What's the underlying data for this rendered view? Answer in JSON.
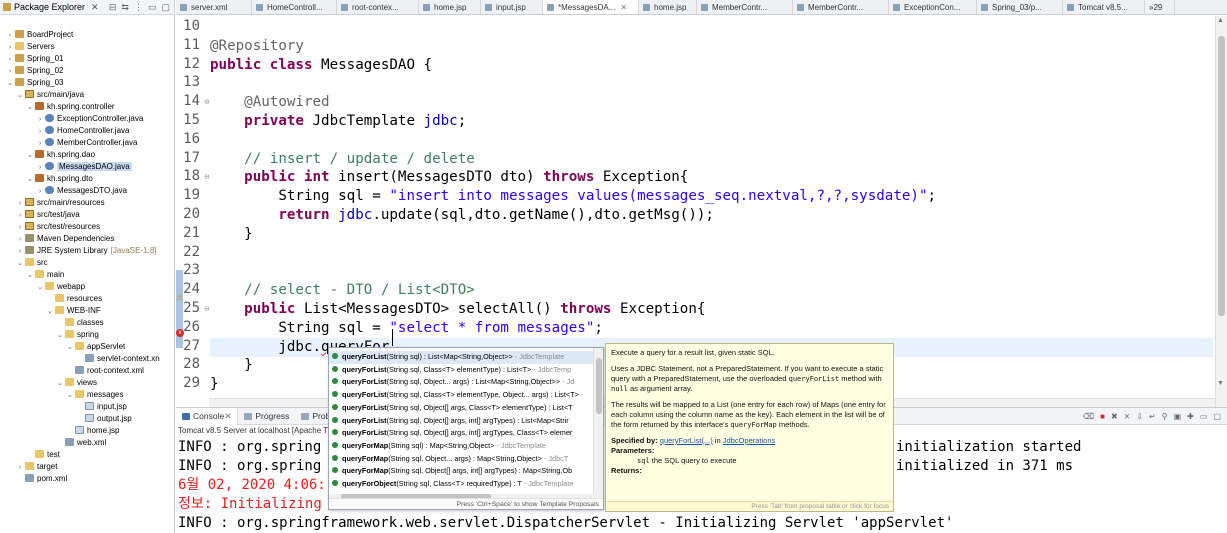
{
  "package_explorer": {
    "title": "Package Explorer",
    "tree": [
      {
        "label": "BoardProject",
        "icon": "project",
        "indent": 0,
        "twisty": ">"
      },
      {
        "label": "Servers",
        "icon": "folder",
        "indent": 0,
        "twisty": ">"
      },
      {
        "label": "Spring_01",
        "icon": "project",
        "indent": 0,
        "twisty": ">"
      },
      {
        "label": "Spring_02",
        "icon": "project",
        "indent": 0,
        "twisty": ">"
      },
      {
        "label": "Spring_03",
        "icon": "project",
        "indent": 0,
        "twisty": "v"
      },
      {
        "label": "src/main/java",
        "icon": "srcfolder",
        "indent": 1,
        "twisty": "v"
      },
      {
        "label": "kh.spring.controller",
        "icon": "pkg",
        "indent": 2,
        "twisty": "v"
      },
      {
        "label": "ExceptionController.java",
        "icon": "java",
        "indent": 3,
        "twisty": ">"
      },
      {
        "label": "HomeController.java",
        "icon": "java",
        "indent": 3,
        "twisty": ">"
      },
      {
        "label": "MemberController.java",
        "icon": "java",
        "indent": 3,
        "twisty": ">"
      },
      {
        "label": "kh.spring.dao",
        "icon": "pkg",
        "indent": 2,
        "twisty": "v"
      },
      {
        "label": "MessagesDAO.java",
        "icon": "java",
        "indent": 3,
        "twisty": ">",
        "selected": true
      },
      {
        "label": "kh.spring.dto",
        "icon": "pkg",
        "indent": 2,
        "twisty": "v"
      },
      {
        "label": "MessagesDTO.java",
        "icon": "java",
        "indent": 3,
        "twisty": ">"
      },
      {
        "label": "src/main/resources",
        "icon": "srcfolder",
        "indent": 1,
        "twisty": ">"
      },
      {
        "label": "src/test/java",
        "icon": "srcfolder",
        "indent": 1,
        "twisty": ">"
      },
      {
        "label": "src/test/resources",
        "icon": "srcfolder",
        "indent": 1,
        "twisty": ">"
      },
      {
        "label": "Maven Dependencies",
        "icon": "lib",
        "indent": 1,
        "twisty": ">"
      },
      {
        "label": "JRE System Library",
        "extra": "[JavaSE-1.8]",
        "icon": "lib",
        "indent": 1,
        "twisty": ">"
      },
      {
        "label": "src",
        "icon": "folder",
        "indent": 1,
        "twisty": "v"
      },
      {
        "label": "main",
        "icon": "folder",
        "indent": 2,
        "twisty": "v"
      },
      {
        "label": "webapp",
        "icon": "folder",
        "indent": 3,
        "twisty": "v"
      },
      {
        "label": "resources",
        "icon": "folder",
        "indent": 4,
        "twisty": ""
      },
      {
        "label": "WEB-INF",
        "icon": "folder",
        "indent": 4,
        "twisty": "v"
      },
      {
        "label": "classes",
        "icon": "folder",
        "indent": 5,
        "twisty": ""
      },
      {
        "label": "spring",
        "icon": "folder",
        "indent": 5,
        "twisty": "v"
      },
      {
        "label": "appServlet",
        "icon": "folder",
        "indent": 6,
        "twisty": "v"
      },
      {
        "label": "servlet-context.xn",
        "icon": "xml",
        "indent": 7,
        "twisty": ""
      },
      {
        "label": "root-context.xml",
        "icon": "xml",
        "indent": 6,
        "twisty": ""
      },
      {
        "label": "views",
        "icon": "folder",
        "indent": 5,
        "twisty": "v"
      },
      {
        "label": "messages",
        "icon": "folder",
        "indent": 6,
        "twisty": "v"
      },
      {
        "label": "input.jsp",
        "icon": "jsp",
        "indent": 7,
        "twisty": ""
      },
      {
        "label": "output.jsp",
        "icon": "jsp",
        "indent": 7,
        "twisty": ""
      },
      {
        "label": "home.jsp",
        "icon": "jsp",
        "indent": 6,
        "twisty": ""
      },
      {
        "label": "web.xml",
        "icon": "xml",
        "indent": 5,
        "twisty": ""
      },
      {
        "label": "test",
        "icon": "folder",
        "indent": 2,
        "twisty": ""
      },
      {
        "label": "target",
        "icon": "folder",
        "indent": 1,
        "twisty": ">"
      },
      {
        "label": "pom.xml",
        "icon": "xml",
        "indent": 1,
        "twisty": ""
      }
    ]
  },
  "editor_tabs": [
    {
      "label": "server.xml",
      "width": 76
    },
    {
      "label": "HomeControll...",
      "width": 85
    },
    {
      "label": "root-contex...",
      "width": 82
    },
    {
      "label": "home.jsp",
      "width": 62
    },
    {
      "label": "input.jsp",
      "width": 62
    },
    {
      "label": "*MessagesDA...",
      "width": 96,
      "active": true
    },
    {
      "label": "home.jsp",
      "width": 58
    },
    {
      "label": "MemberContr...",
      "width": 96
    },
    {
      "label": "MemberContr...",
      "width": 96
    },
    {
      "label": "ExceptionCon...",
      "width": 88
    },
    {
      "label": "Spring_03/p...",
      "width": 86
    },
    {
      "label": "Tomcat v8.5...",
      "width": 82
    },
    {
      "label": "»29",
      "width": 30
    }
  ],
  "code": {
    "lines": [
      {
        "n": "10",
        "html": ""
      },
      {
        "n": "11",
        "html": "<span class=\"an\">@Repository</span>"
      },
      {
        "n": "12",
        "html": "<span class=\"kw\">public</span> <span class=\"kw\">class</span> MessagesDAO {"
      },
      {
        "n": "13",
        "html": ""
      },
      {
        "n": "14",
        "html": "    <span class=\"an\">@Autowired</span>",
        "fold": true
      },
      {
        "n": "15",
        "html": "    <span class=\"kw\">private</span> JdbcTemplate <span class=\"fd\">jdbc</span>;"
      },
      {
        "n": "16",
        "html": ""
      },
      {
        "n": "17",
        "html": "    <span class=\"cm\">// insert / update / delete</span>"
      },
      {
        "n": "18",
        "html": "    <span class=\"kw\">public</span> <span class=\"kw\">int</span> insert(MessagesDTO dto) <span class=\"kw\">throws</span> Exception{",
        "fold": true
      },
      {
        "n": "19",
        "html": "        String sql = <span class=\"st\">\"insert into messages values(messages_seq.nextval,?,?,sysdate)\"</span>;"
      },
      {
        "n": "20",
        "html": "        <span class=\"kw\">return</span> <span class=\"fd\">jdbc</span>.update(sql,dto.getName(),dto.getMsg());"
      },
      {
        "n": "21",
        "html": "    }"
      },
      {
        "n": "22",
        "html": ""
      },
      {
        "n": "23",
        "html": ""
      },
      {
        "n": "24",
        "html": "    <span class=\"cm\">// select - DTO / List&lt;DTO&gt;</span>"
      },
      {
        "n": "25",
        "html": "    <span class=\"kw\">public</span> List&lt;MessagesDTO&gt; selectAll() <span class=\"kw\">throws</span> Exception{",
        "fold": true
      },
      {
        "n": "26",
        "html": "        String sql = <span class=\"st\">\"select * from messages\"</span>;"
      },
      {
        "n": "27",
        "html": "        jdbc.<span class=\"err-under\">queryFor</span>",
        "current": true,
        "error": true
      },
      {
        "n": "28",
        "html": "    }"
      },
      {
        "n": "29",
        "html": "}"
      }
    ]
  },
  "console": {
    "tabs": [
      "Console",
      "Progress",
      "Proble"
    ],
    "description": "Tomcat v8.5 Server at localhost [Apache T",
    "lines": [
      {
        "text": "INFO : org.spring",
        "right": "initialization started",
        "color": "black"
      },
      {
        "text": "INFO : org.spring",
        "right": "initialized in 371 ms",
        "color": "black"
      },
      {
        "text": "6월 02, 2020 4:06:",
        "right": "",
        "color": "red"
      },
      {
        "text": "정보: Initializing",
        "right": "",
        "color": "red"
      },
      {
        "text": "INFO : org.springframework.web.servlet.DispatcherServlet - Initializing Servlet 'appServlet'",
        "right": "",
        "color": "black"
      }
    ]
  },
  "content_assist": {
    "proposals": [
      {
        "name": "queryForList",
        "sig": "(String sql) : List<Map<String,Object>>",
        "type": " - JdbcTemplate",
        "selected": true
      },
      {
        "name": "queryForList",
        "sig": "(String sql, Class<T> elementType) : List<T>",
        "type": " - JdbcTemp"
      },
      {
        "name": "queryForList",
        "sig": "(String sql, Object... args) : List<Map<String,Object>>",
        "type": " - Jd"
      },
      {
        "name": "queryForList",
        "sig": "(String sql, Class<T> elementType, Object... args) : List<T>",
        "type": ""
      },
      {
        "name": "queryForList",
        "sig": "(String sql, Object[] args, Class<T> elementType) : List<T",
        "type": ""
      },
      {
        "name": "queryForList",
        "sig": "(String sql, Object[] args, int[] argTypes) : List<Map<Strir",
        "type": ""
      },
      {
        "name": "queryForList",
        "sig": "(String sql, Object[] args, int[] argTypes, Class<T> elemer",
        "type": ""
      },
      {
        "name": "queryForMap",
        "sig": "(String sql) : Map<String,Object>",
        "type": " - JdbcTemplate"
      },
      {
        "name": "queryForMap",
        "sig": "(String sql, Object... args) : Map<String,Object>",
        "type": " - JdbcT"
      },
      {
        "name": "queryForMap",
        "sig": "(String sql, Object[] args, int[] argTypes) : Map<String,Ob",
        "type": ""
      },
      {
        "name": "queryForObject",
        "sig": "(String sql, Class<T> requiredType) : T",
        "type": " - JdbcTemplate"
      }
    ],
    "status": "Press 'Ctrl+Space' to show Template Proposals"
  },
  "javadoc": {
    "summary": "Execute a query for a result list, given static SQL.",
    "p2_a": "Uses a JDBC Statement, not a PreparedStatement. If you want to execute a static query with a PreparedStatement, use the overloaded ",
    "p2_code": "queryForList",
    "p2_b": " method with ",
    "p2_null": "null",
    "p2_c": " as argument array.",
    "p3_a": "The results will be mapped to a List (one entry for each row) of Maps (one entry for each column using the column name as the key). Each element in the list will be of the form returned by this interface's ",
    "p3_code": "queryForMap",
    "p3_b": " methods.",
    "specified_by_label": "Specified by:",
    "specified_by_link": "queryForList(...)",
    "specified_in": " in ",
    "specified_iface": "JdbcOperations",
    "parameters_label": "Parameters:",
    "param_name": "sql",
    "param_desc": " the SQL query to execute",
    "returns_label": "Returns:",
    "footer": "Press 'Tab' from proposal table or click for focus"
  }
}
